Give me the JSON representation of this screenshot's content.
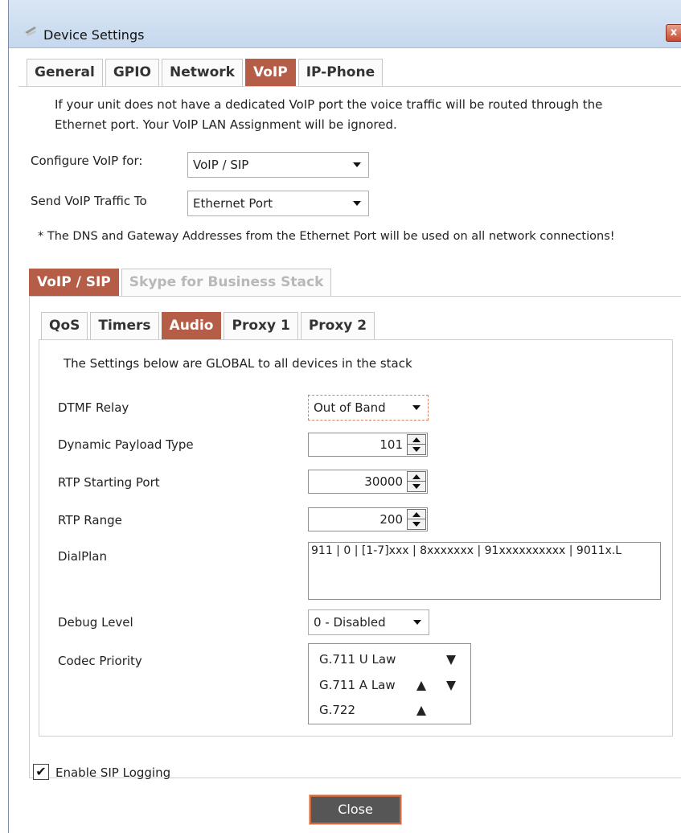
{
  "window": {
    "title": "Device Settings",
    "close_glyph": "x"
  },
  "main_tabs": [
    "General",
    "GPIO",
    "Network",
    "VoIP",
    "IP-Phone"
  ],
  "main_active_tab": "VoIP",
  "info_text_line1": "If your unit does not have a dedicated VoIP port the voice traffic will be routed through the",
  "info_text_line2": "Ethernet port.  Your VoIP LAN Assignment will be ignored.",
  "configure_voip": {
    "label": "Configure VoIP for:",
    "value": "VoIP / SIP"
  },
  "send_traffic": {
    "label": "Send VoIP Traffic To",
    "value": "Ethernet Port"
  },
  "dns_note": "* The DNS and Gateway Addresses from the Ethernet Port will be used on all network connections!",
  "stack_tabs": [
    "VoIP / SIP",
    "Skype for Business Stack"
  ],
  "sub_tabs": [
    "QoS",
    "Timers",
    "Audio",
    "Proxy 1",
    "Proxy 2"
  ],
  "audio": {
    "global_note": "The Settings below are GLOBAL to all devices in the stack",
    "dtmf_relay": {
      "label": "DTMF Relay",
      "value": "Out of Band"
    },
    "dynamic_payload": {
      "label": "Dynamic Payload Type",
      "value": "101"
    },
    "rtp_start": {
      "label": "RTP Starting Port",
      "value": "30000"
    },
    "rtp_range": {
      "label": "RTP Range",
      "value": "200"
    },
    "dialplan": {
      "label": "DialPlan",
      "value": "911 | 0 | [1-7]xxx | 8xxxxxxx | 91xxxxxxxxxx | 9011x.L"
    },
    "debug_level": {
      "label": "Debug Level",
      "value": "0 - Disabled"
    },
    "codec_priority": {
      "label": "Codec Priority",
      "items": [
        "G.711 U Law",
        "G.711 A Law",
        "G.722"
      ]
    }
  },
  "enable_sip_logging": {
    "label": "Enable SIP Logging",
    "checked": true,
    "check_glyph": "✔"
  },
  "close_button": "Close",
  "colors": {
    "accent_tab": "#b55d47",
    "close_button_bg": "#565656",
    "close_button_border": "#d1683f"
  }
}
